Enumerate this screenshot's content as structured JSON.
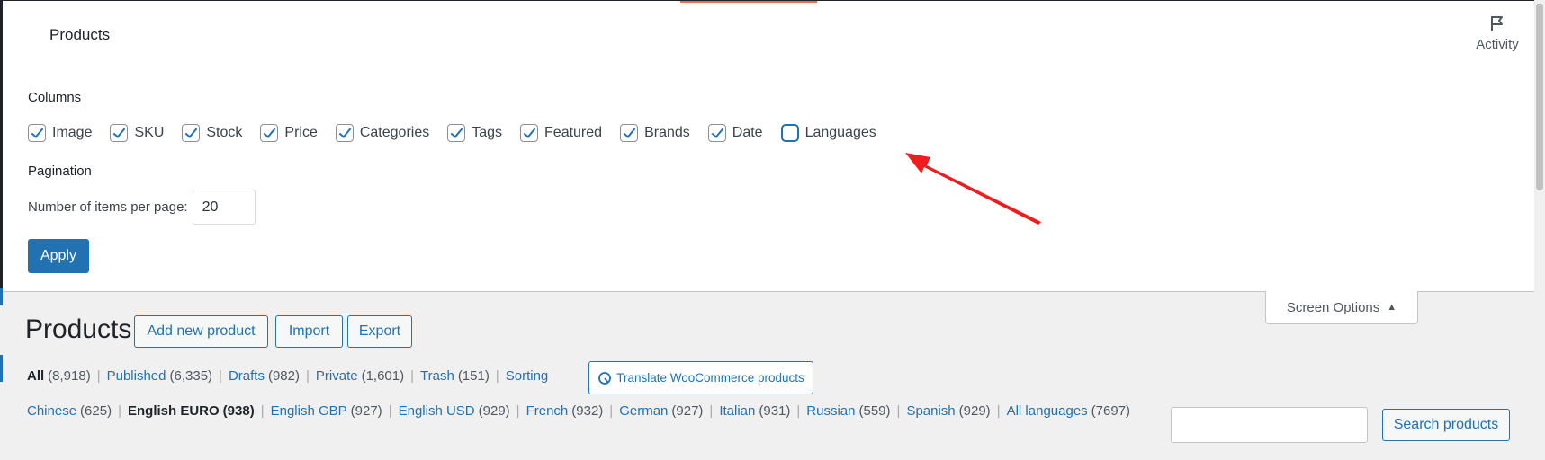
{
  "screen_options": {
    "page_label": "Products",
    "activity_label": "Activity",
    "columns_title": "Columns",
    "columns": [
      {
        "label": "Image",
        "checked": true
      },
      {
        "label": "SKU",
        "checked": true
      },
      {
        "label": "Stock",
        "checked": true
      },
      {
        "label": "Price",
        "checked": true
      },
      {
        "label": "Categories",
        "checked": true
      },
      {
        "label": "Tags",
        "checked": true
      },
      {
        "label": "Featured",
        "checked": true
      },
      {
        "label": "Brands",
        "checked": true
      },
      {
        "label": "Date",
        "checked": true
      },
      {
        "label": "Languages",
        "checked": false
      }
    ],
    "pagination_title": "Pagination",
    "items_per_page_label": "Number of items per page:",
    "items_per_page_value": "20",
    "apply_label": "Apply",
    "tab_label": "Screen Options",
    "tab_arrow": "▲"
  },
  "header": {
    "title": "Products",
    "add_new_label": "Add new product",
    "import_label": "Import",
    "export_label": "Export"
  },
  "status_filters": [
    {
      "label": "All",
      "count": "(8,918)",
      "current": true
    },
    {
      "label": "Published",
      "count": "(6,335)",
      "current": false
    },
    {
      "label": "Drafts",
      "count": "(982)",
      "current": false
    },
    {
      "label": "Private",
      "count": "(1,601)",
      "current": false
    },
    {
      "label": "Trash",
      "count": "(151)",
      "current": false
    },
    {
      "label": "Sorting",
      "count": "",
      "current": false
    }
  ],
  "translate_label": "Translate WooCommerce products",
  "language_filters": [
    {
      "label": "Chinese",
      "count": "(625)",
      "current": false
    },
    {
      "label": "English EURO",
      "count": "(938)",
      "current": true
    },
    {
      "label": "English GBP",
      "count": "(927)",
      "current": false
    },
    {
      "label": "English USD",
      "count": "(929)",
      "current": false
    },
    {
      "label": "French",
      "count": "(932)",
      "current": false
    },
    {
      "label": "German",
      "count": "(927)",
      "current": false
    },
    {
      "label": "Italian",
      "count": "(931)",
      "current": false
    },
    {
      "label": "Russian",
      "count": "(559)",
      "current": false
    },
    {
      "label": "Spanish",
      "count": "(929)",
      "current": false
    },
    {
      "label": "All languages",
      "count": "(7697)",
      "current": false
    }
  ],
  "search": {
    "value": "",
    "button_label": "Search products"
  },
  "colors": {
    "accent": "#2271b1",
    "annotation_arrow": "#ee1c1c"
  }
}
